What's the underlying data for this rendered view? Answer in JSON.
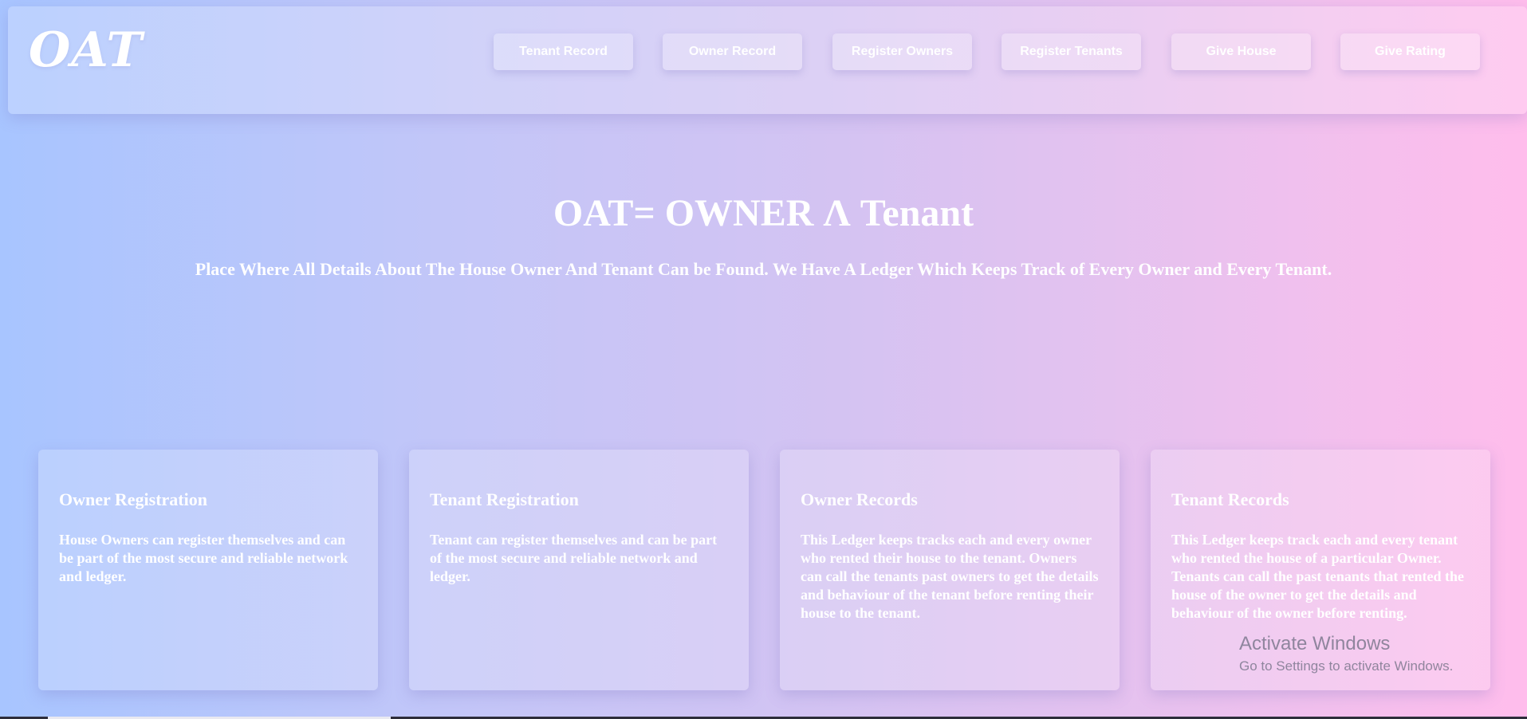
{
  "header": {
    "logo": "OAT",
    "nav": [
      {
        "label": "Tenant Record"
      },
      {
        "label": "Owner Record"
      },
      {
        "label": "Register Owners"
      },
      {
        "label": "Register Tenants"
      },
      {
        "label": "Give House"
      },
      {
        "label": "Give Rating"
      }
    ]
  },
  "hero": {
    "title": "OAT= OWNER Λ Tenant",
    "subtitle": "Place Where All Details About The House Owner And Tenant Can be Found. We Have A Ledger Which Keeps Track of Every Owner and Every Tenant."
  },
  "cards": [
    {
      "title": "Owner Registration",
      "text": "House Owners can register themselves and can be part of the most secure and reliable network and ledger."
    },
    {
      "title": "Tenant Registration",
      "text": "Tenant can register themselves and can be part of the most secure and reliable network and ledger."
    },
    {
      "title": "Owner Records",
      "text": "This Ledger keeps tracks each and every owner who rented their house to the tenant. Owners can call the tenants past owners to get the details and behaviour of the tenant before renting their house to the tenant."
    },
    {
      "title": "Tenant Records",
      "text": "This Ledger keeps track each and every tenant who rented the house of a particular Owner. Tenants can call the past tenants that rented the house of the owner to get the details and behaviour of the owner before renting."
    }
  ],
  "watermark": {
    "title": "Activate Windows",
    "subtitle": "Go to Settings to activate Windows."
  }
}
